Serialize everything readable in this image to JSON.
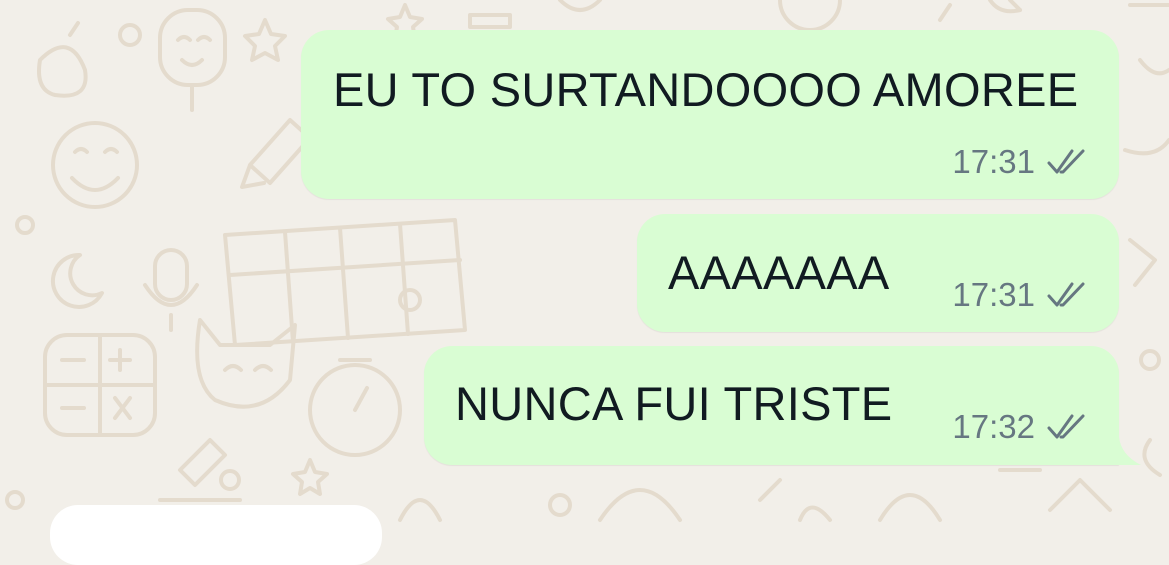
{
  "chat": {
    "colors": {
      "wallpaper": "#f2efe9",
      "wallpaper_doodle": "#e4dbcd",
      "outgoing_bubble": "#d9fdd3",
      "incoming_bubble": "#ffffff",
      "text": "#111b21",
      "meta": "#667781"
    },
    "messages": [
      {
        "text": "EU TO SURTANDOOOO AMOREE",
        "time": "17:31",
        "status_icon": "double-check-icon"
      },
      {
        "text": "AAAAAAA",
        "time": "17:31",
        "status_icon": "double-check-icon"
      },
      {
        "text": "NUNCA FUI TRISTE",
        "time": "17:32",
        "status_icon": "double-check-icon"
      }
    ]
  }
}
